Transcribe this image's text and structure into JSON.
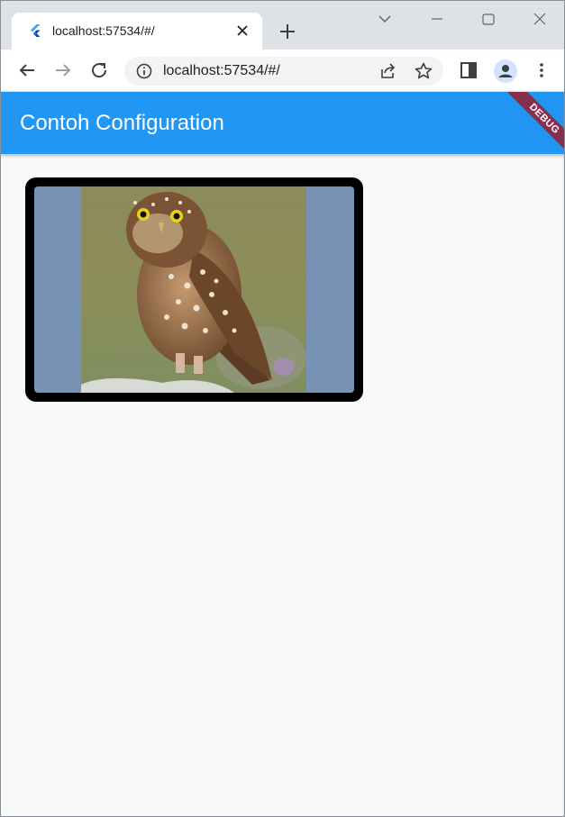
{
  "browser": {
    "tab": {
      "title": "localhost:57534/#/",
      "favicon": "flutter-icon",
      "close_icon": "close-icon"
    },
    "new_tab_icon": "plus-icon",
    "window_controls": [
      "chevron-down-icon",
      "minimize-icon",
      "maximize-icon",
      "close-icon"
    ],
    "toolbar": {
      "back_icon": "arrow-left-icon",
      "forward_icon": "arrow-right-icon",
      "reload_icon": "reload-icon",
      "site_info_icon": "info-icon",
      "url": "localhost:57534/#/",
      "share_icon": "share-icon",
      "bookmark_icon": "star-icon",
      "sidepanel_icon": "sidepanel-icon",
      "profile_icon": "profile-avatar-icon",
      "menu_icon": "kebab-menu-icon"
    }
  },
  "app": {
    "title": "Contoh Configuration",
    "debug_banner": "DEBUG",
    "accent": "#2196f3",
    "image": {
      "subject": "owl-photo",
      "background": "#7792b5",
      "frame": "#000000"
    }
  }
}
